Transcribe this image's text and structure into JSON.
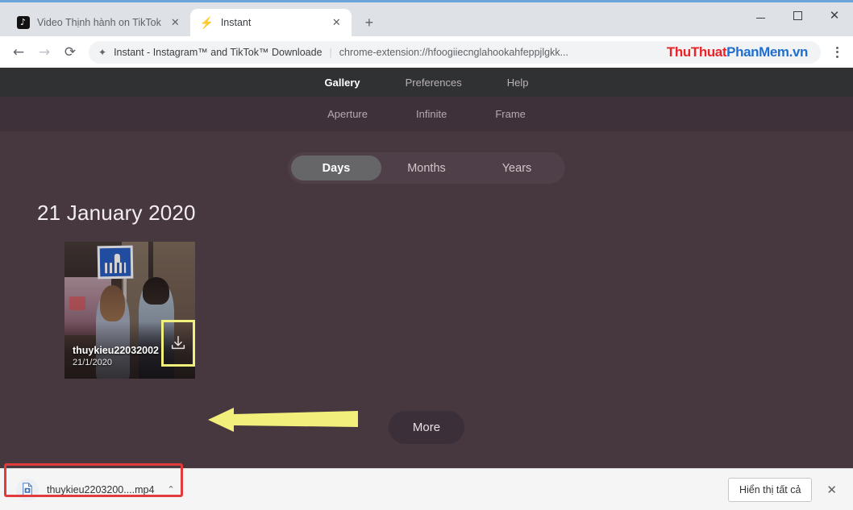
{
  "browser": {
    "tabs": [
      {
        "title": "Video Thịnh hành on TikTok",
        "favicon": "tiktok-icon",
        "active": false,
        "close_label": "✕"
      },
      {
        "title": "Instant",
        "favicon": "bolt-icon",
        "active": true,
        "close_label": "✕"
      }
    ],
    "new_tab_label": "+",
    "window_controls": {
      "minimize": "minimize-icon",
      "maximize": "maximize-icon",
      "close": "✕"
    },
    "toolbar": {
      "back": "←",
      "forward": "→",
      "reload": "⟳",
      "omnibox": {
        "extension_icon": "puzzle-piece-icon",
        "extension_name": "Instant - Instagram™ and TikTok™ Downloade",
        "separator": "|",
        "url": "chrome-extension://hfoogiiecnglahookahfeppjlgkk..."
      },
      "menu": "three-dot-menu-icon"
    },
    "watermark": {
      "part_red": "ThuThuat",
      "part_blue": "PhanMem.vn"
    }
  },
  "page": {
    "nav_primary": [
      {
        "label": "Gallery",
        "active": true
      },
      {
        "label": "Preferences",
        "active": false
      },
      {
        "label": "Help",
        "active": false
      }
    ],
    "nav_secondary": [
      {
        "label": "Aperture"
      },
      {
        "label": "Infinite"
      },
      {
        "label": "Frame"
      }
    ],
    "segmented": [
      {
        "label": "Days",
        "active": true
      },
      {
        "label": "Months",
        "active": false
      },
      {
        "label": "Years",
        "active": false
      }
    ],
    "date_heading": "21 January 2020",
    "items": [
      {
        "username": "thuykieu22032002",
        "date": "21/1/2020",
        "download_icon": "download-icon"
      }
    ],
    "more_label": "More",
    "annotations": {
      "arrow_color": "#f2f07a",
      "highlight_color": "#f0f07a",
      "redbox_color": "#e13b3b"
    }
  },
  "download_shelf": {
    "file_icon": "video-file-icon",
    "file_name": "thuykieu2203200....mp4",
    "caret": "⌃",
    "show_all_label": "Hiển thị tất cả",
    "close_label": "✕"
  }
}
